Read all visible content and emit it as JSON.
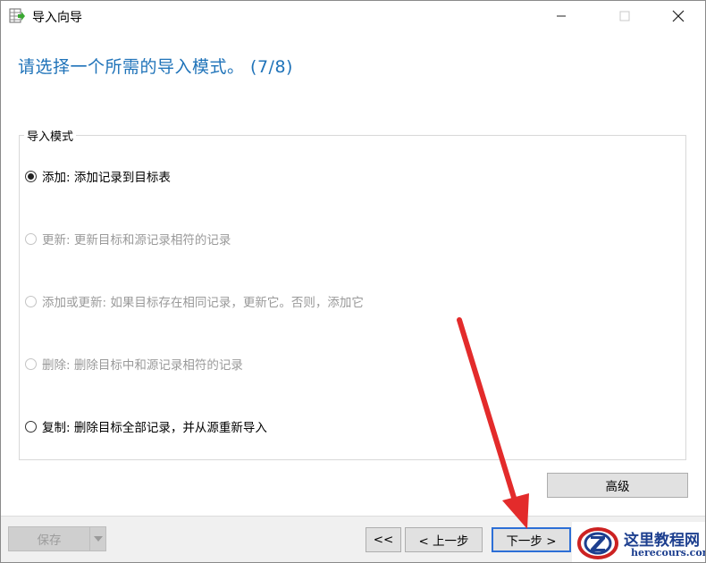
{
  "window": {
    "title": "导入向导"
  },
  "heading": "请选择一个所需的导入模式。 (7/8)",
  "import_mode": {
    "group_label": "导入模式",
    "options": [
      {
        "label": "添加: 添加记录到目标表",
        "checked": true,
        "enabled": true
      },
      {
        "label": "更新: 更新目标和源记录相符的记录",
        "checked": false,
        "enabled": false
      },
      {
        "label": "添加或更新: 如果目标存在相同记录，更新它。否则，添加它",
        "checked": false,
        "enabled": false
      },
      {
        "label": "删除: 删除目标中和源记录相符的记录",
        "checked": false,
        "enabled": false
      },
      {
        "label": "复制: 删除目标全部记录，并从源重新导入",
        "checked": false,
        "enabled": true
      }
    ]
  },
  "buttons": {
    "advanced": "高级",
    "save": "保存",
    "first": "<<",
    "prev": "< 上一步",
    "next": "下一步 >"
  },
  "watermark": {
    "cn": "这里教程网",
    "en": "herecours.com"
  },
  "colors": {
    "heading": "#1f73b9",
    "arrow": "#e32b2b",
    "next_focus": "#2d6fd6"
  },
  "icons": {
    "app": "import-wizard-icon",
    "minimize": "minimize-icon",
    "maximize": "maximize-icon",
    "close": "close-icon",
    "dropdown": "chevron-down-icon"
  }
}
